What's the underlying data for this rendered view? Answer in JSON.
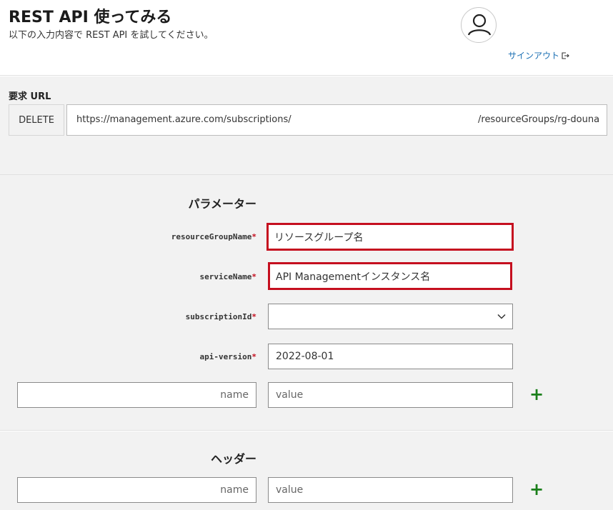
{
  "header": {
    "title": "REST API 使ってみる",
    "subtitle": "以下の入力内容で REST API を試してください。",
    "signout_label": "サインアウト"
  },
  "request_url": {
    "label": "要求 URL",
    "method": "DELETE",
    "url_part1": "https://management.azure.com/subscriptions/",
    "url_part2": "/resourceGroups/rg-douna"
  },
  "parameters": {
    "title": "パラメーター",
    "fields": [
      {
        "name": "resourceGroupName",
        "required": "*",
        "value": "リソースグループ名"
      },
      {
        "name": "serviceName",
        "required": "*",
        "value": "API Managementインスタンス名"
      },
      {
        "name": "subscriptionId",
        "required": "*",
        "value": ""
      },
      {
        "name": "api-version",
        "required": "*",
        "value": "2022-08-01"
      }
    ],
    "custom_name_placeholder": "name",
    "custom_value_placeholder": "value",
    "add_label": "+"
  },
  "headers": {
    "title": "ヘッダー",
    "custom_name_placeholder": "name",
    "custom_value_placeholder": "value",
    "add_label": "+"
  },
  "colors": {
    "highlight": "#c50f1f",
    "link": "#1a6fb3",
    "add": "#1a7f1a"
  }
}
